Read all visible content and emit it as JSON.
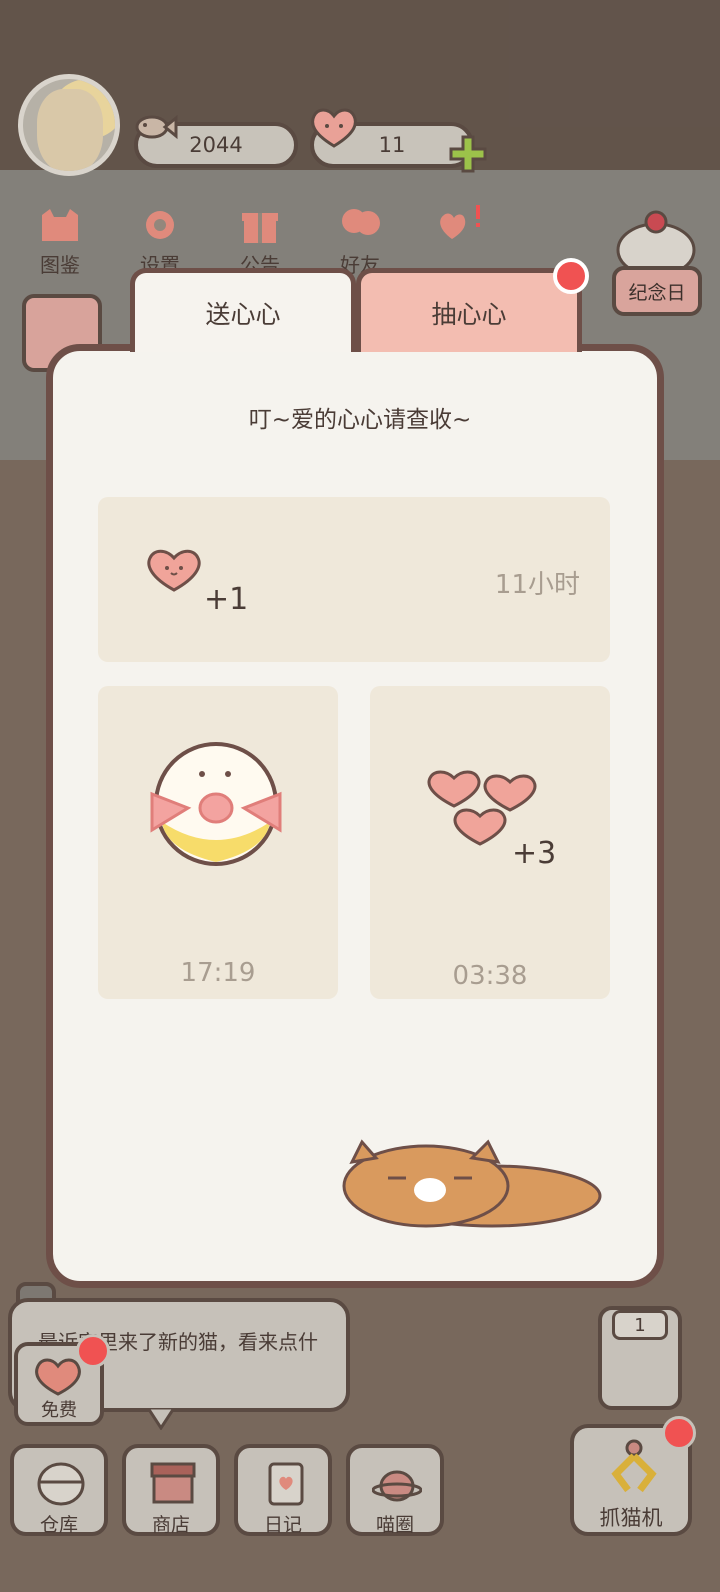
{
  "currency": {
    "fish": "2044",
    "hearts": "11"
  },
  "top_nav": [
    {
      "label": "图鉴",
      "icon": "cat-head-icon"
    },
    {
      "label": "设置",
      "icon": "gear-icon"
    },
    {
      "label": "公告",
      "icon": "gift-icon"
    },
    {
      "label": "好友",
      "icon": "friends-icon"
    },
    {
      "label": "",
      "icon": "hearts-icon"
    }
  ],
  "anniversary_label": "纪念日",
  "tabs": {
    "send": "送心心",
    "draw": "抽心心"
  },
  "dialog": {
    "title": "叮~爱的心心请查收~",
    "card_top": {
      "amount": "+1",
      "time": "11小时"
    },
    "card_left": {
      "time": "17:19"
    },
    "card_right": {
      "amount": "+3",
      "time": "03:38"
    }
  },
  "speech_text": "最近家里来了新的猫，看来点什么",
  "free_label": "免费",
  "elevator_floor": "1",
  "bottom_nav": [
    {
      "label": "仓库",
      "icon": "storage-icon"
    },
    {
      "label": "商店",
      "icon": "shop-icon"
    },
    {
      "label": "日记",
      "icon": "diary-icon"
    },
    {
      "label": "喵圈",
      "icon": "cat-planet-icon"
    }
  ],
  "claw_label": "抓猫机",
  "colors": {
    "accent_pink": "#f3bdb1",
    "badge_red": "#f05252",
    "outline": "#6e4f48",
    "panel": "#f5f3ee",
    "card": "#efe8da"
  }
}
